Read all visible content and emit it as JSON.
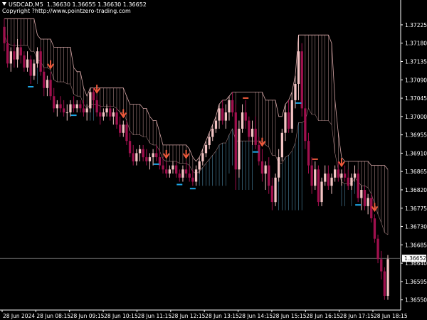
{
  "header": {
    "line1": "USDCAD,M5  1.36630 1.36655 1.36630 1.36652",
    "line2": "Copyright ?http://www.pointzero-trading.com"
  },
  "colors": {
    "background": "#000000",
    "bull_candle": "#f4c4c4",
    "bear_candle": "#a0104e",
    "cloud_bear": "#d8a8a8",
    "cloud_bull": "#6ab8e0",
    "arrow_down": "#f05a3c",
    "marker_low": "#1ea8e8",
    "marker_high": "#f05a3c",
    "axis_text": "#ffffff",
    "current_line": "#777777"
  },
  "current_price_label": "1.36652",
  "chart_data": {
    "type": "candlestick",
    "symbol": "USDCAD",
    "timeframe": "M5",
    "ylim": [
      1.36525,
      1.37265
    ],
    "yticks": [
      "1.37225",
      "1.37180",
      "1.37135",
      "1.37090",
      "1.37045",
      "1.37000",
      "1.36955",
      "1.36910",
      "1.36865",
      "1.36820",
      "1.36775",
      "1.36730",
      "1.36685",
      "1.36640",
      "1.36595",
      "1.36550"
    ],
    "xticks": [
      "28 Jun 2024",
      "28 Jun 08:15",
      "28 Jun 09:15",
      "28 Jun 10:15",
      "28 Jun 11:15",
      "28 Jun 12:15",
      "28 Jun 13:15",
      "28 Jun 14:15",
      "28 Jun 15:15",
      "28 Jun 16:15",
      "28 Jun 17:15",
      "28 Jun 18:15"
    ],
    "current_price": 1.36652,
    "candles": [
      [
        1.3722,
        1.3724,
        1.3716,
        1.3718
      ],
      [
        1.3718,
        1.372,
        1.3712,
        1.3713
      ],
      [
        1.3713,
        1.3717,
        1.3711,
        1.3716
      ],
      [
        1.3716,
        1.3718,
        1.3712,
        1.3714
      ],
      [
        1.3714,
        1.3719,
        1.3712,
        1.3717
      ],
      [
        1.3717,
        1.3719,
        1.3713,
        1.3715
      ],
      [
        1.3715,
        1.3716,
        1.3711,
        1.3712
      ],
      [
        1.3712,
        1.3716,
        1.3711,
        1.3714
      ],
      [
        1.3714,
        1.3715,
        1.3708,
        1.371
      ],
      [
        1.371,
        1.3714,
        1.3709,
        1.3713
      ],
      [
        1.3713,
        1.3717,
        1.3712,
        1.3716
      ],
      [
        1.3716,
        1.3717,
        1.371,
        1.3711
      ],
      [
        1.3711,
        1.3712,
        1.3705,
        1.3707
      ],
      [
        1.3707,
        1.371,
        1.3705,
        1.3709
      ],
      [
        1.3709,
        1.3711,
        1.3704,
        1.3705
      ],
      [
        1.3705,
        1.3707,
        1.3701,
        1.3702
      ],
      [
        1.3702,
        1.3704,
        1.37,
        1.3703
      ],
      [
        1.3703,
        1.3705,
        1.3701,
        1.3702
      ],
      [
        1.3702,
        1.3704,
        1.37,
        1.3701
      ],
      [
        1.3701,
        1.3703,
        1.3699,
        1.3701
      ],
      [
        1.3701,
        1.3704,
        1.37,
        1.3703
      ],
      [
        1.3703,
        1.3705,
        1.3701,
        1.3702
      ],
      [
        1.3702,
        1.3704,
        1.3701,
        1.3703
      ],
      [
        1.3703,
        1.3704,
        1.3701,
        1.3702
      ],
      [
        1.3702,
        1.3704,
        1.37,
        1.3701
      ],
      [
        1.3701,
        1.3703,
        1.3699,
        1.3702
      ],
      [
        1.3702,
        1.3707,
        1.3701,
        1.3706
      ],
      [
        1.3706,
        1.3707,
        1.3702,
        1.3704
      ],
      [
        1.3704,
        1.3705,
        1.37,
        1.3701
      ],
      [
        1.3701,
        1.3703,
        1.3698,
        1.37
      ],
      [
        1.37,
        1.3702,
        1.3699,
        1.3701
      ],
      [
        1.3701,
        1.3703,
        1.37,
        1.3702
      ],
      [
        1.3702,
        1.3703,
        1.3699,
        1.37
      ],
      [
        1.37,
        1.3702,
        1.3698,
        1.3701
      ],
      [
        1.3701,
        1.3702,
        1.3697,
        1.3698
      ],
      [
        1.3698,
        1.37,
        1.3695,
        1.3696
      ],
      [
        1.3696,
        1.3699,
        1.3695,
        1.3698
      ],
      [
        1.3698,
        1.3699,
        1.3693,
        1.3694
      ],
      [
        1.3694,
        1.3696,
        1.369,
        1.3691
      ],
      [
        1.3691,
        1.3693,
        1.3688,
        1.3689
      ],
      [
        1.3689,
        1.3692,
        1.3688,
        1.3691
      ],
      [
        1.3691,
        1.3693,
        1.3689,
        1.3692
      ],
      [
        1.3692,
        1.3693,
        1.3689,
        1.369
      ],
      [
        1.369,
        1.3692,
        1.3688,
        1.3689
      ],
      [
        1.3689,
        1.3691,
        1.3687,
        1.369
      ],
      [
        1.369,
        1.3692,
        1.3688,
        1.3691
      ],
      [
        1.3691,
        1.3693,
        1.3689,
        1.369
      ],
      [
        1.369,
        1.3692,
        1.3687,
        1.3688
      ],
      [
        1.3688,
        1.369,
        1.3686,
        1.3687
      ],
      [
        1.3687,
        1.3689,
        1.3685,
        1.3686
      ],
      [
        1.3686,
        1.3688,
        1.3685,
        1.3687
      ],
      [
        1.3687,
        1.3689,
        1.3686,
        1.3688
      ],
      [
        1.3688,
        1.3689,
        1.3685,
        1.3686
      ],
      [
        1.3686,
        1.3687,
        1.3684,
        1.3685
      ],
      [
        1.3685,
        1.3688,
        1.3684,
        1.3687
      ],
      [
        1.3687,
        1.3689,
        1.3685,
        1.3686
      ],
      [
        1.3686,
        1.3688,
        1.3684,
        1.3685
      ],
      [
        1.3685,
        1.3687,
        1.3683,
        1.3684
      ],
      [
        1.3684,
        1.3688,
        1.3683,
        1.3687
      ],
      [
        1.3687,
        1.369,
        1.3686,
        1.3689
      ],
      [
        1.3689,
        1.3692,
        1.3688,
        1.3691
      ],
      [
        1.3691,
        1.3694,
        1.369,
        1.3693
      ],
      [
        1.3693,
        1.3696,
        1.3692,
        1.3695
      ],
      [
        1.3695,
        1.3698,
        1.3694,
        1.3697
      ],
      [
        1.3697,
        1.37,
        1.3696,
        1.3699
      ],
      [
        1.3699,
        1.3703,
        1.3697,
        1.3702
      ],
      [
        1.3702,
        1.3704,
        1.3698,
        1.3699
      ],
      [
        1.3699,
        1.3703,
        1.3697,
        1.3701
      ],
      [
        1.3701,
        1.3705,
        1.3699,
        1.3704
      ],
      [
        1.3704,
        1.3706,
        1.37,
        1.3701
      ],
      [
        1.3701,
        1.3703,
        1.3682,
        1.3687
      ],
      [
        1.3687,
        1.3699,
        1.3685,
        1.3697
      ],
      [
        1.3697,
        1.3703,
        1.3696,
        1.3701
      ],
      [
        1.3701,
        1.3704,
        1.3697,
        1.3699
      ],
      [
        1.3699,
        1.37,
        1.3694,
        1.3695
      ],
      [
        1.3695,
        1.3699,
        1.3693,
        1.3697
      ],
      [
        1.3697,
        1.37,
        1.3692,
        1.3693
      ],
      [
        1.3693,
        1.3695,
        1.3688,
        1.3689
      ],
      [
        1.3689,
        1.3692,
        1.3684,
        1.3686
      ],
      [
        1.3686,
        1.3689,
        1.3682,
        1.3688
      ],
      [
        1.3688,
        1.369,
        1.3681,
        1.3683
      ],
      [
        1.3683,
        1.3685,
        1.3677,
        1.3679
      ],
      [
        1.3679,
        1.3686,
        1.3678,
        1.3685
      ],
      [
        1.3685,
        1.3692,
        1.3684,
        1.369
      ],
      [
        1.369,
        1.3697,
        1.3689,
        1.3696
      ],
      [
        1.3696,
        1.3703,
        1.3694,
        1.3701
      ],
      [
        1.3701,
        1.3704,
        1.3696,
        1.3697
      ],
      [
        1.3697,
        1.3706,
        1.3696,
        1.3704
      ],
      [
        1.3704,
        1.371,
        1.3702,
        1.3708
      ],
      [
        1.3708,
        1.372,
        1.3704,
        1.3716
      ],
      [
        1.3716,
        1.3718,
        1.37,
        1.3702
      ],
      [
        1.3702,
        1.3704,
        1.3692,
        1.3694
      ],
      [
        1.3694,
        1.3696,
        1.3686,
        1.3688
      ],
      [
        1.3688,
        1.369,
        1.3681,
        1.3683
      ],
      [
        1.3683,
        1.3689,
        1.3682,
        1.3687
      ],
      [
        1.3687,
        1.3688,
        1.3678,
        1.3679
      ],
      [
        1.3679,
        1.3685,
        1.3678,
        1.3684
      ],
      [
        1.3684,
        1.3688,
        1.3683,
        1.3686
      ],
      [
        1.3686,
        1.3688,
        1.3682,
        1.3683
      ],
      [
        1.3683,
        1.3686,
        1.3681,
        1.3685
      ],
      [
        1.3685,
        1.3688,
        1.3684,
        1.3687
      ],
      [
        1.3687,
        1.3689,
        1.3684,
        1.3685
      ],
      [
        1.3685,
        1.3687,
        1.3683,
        1.3686
      ],
      [
        1.3686,
        1.3688,
        1.3684,
        1.3685
      ],
      [
        1.3685,
        1.3687,
        1.3682,
        1.3683
      ],
      [
        1.3683,
        1.3686,
        1.3682,
        1.3685
      ],
      [
        1.3685,
        1.3688,
        1.3684,
        1.3686
      ],
      [
        1.3686,
        1.3687,
        1.3679,
        1.368
      ],
      [
        1.368,
        1.3683,
        1.3677,
        1.3682
      ],
      [
        1.3682,
        1.3683,
        1.3677,
        1.3678
      ],
      [
        1.3678,
        1.3681,
        1.3676,
        1.368
      ],
      [
        1.368,
        1.3681,
        1.3674,
        1.3675
      ],
      [
        1.3675,
        1.3676,
        1.3669,
        1.367
      ],
      [
        1.367,
        1.3671,
        1.3664,
        1.3665
      ],
      [
        1.3665,
        1.3667,
        1.366,
        1.3662
      ],
      [
        1.3662,
        1.3663,
        1.3655,
        1.3656
      ],
      [
        1.3656,
        1.3666,
        1.3655,
        1.3665
      ]
    ],
    "signals": [
      {
        "type": "down_arrow",
        "bar": 14
      },
      {
        "type": "down_arrow",
        "bar": 28
      },
      {
        "type": "down_arrow",
        "bar": 36
      },
      {
        "type": "down_arrow",
        "bar": 49
      },
      {
        "type": "down_arrow",
        "bar": 55
      },
      {
        "type": "down_arrow",
        "bar": 78
      },
      {
        "type": "down_arrow",
        "bar": 102
      },
      {
        "type": "down_arrow",
        "bar": 112
      },
      {
        "type": "down_arrow",
        "bar": 120
      },
      {
        "type": "down_arrow",
        "bar": 126
      },
      {
        "type": "low_marker",
        "bar": 8
      },
      {
        "type": "low_marker",
        "bar": 21
      },
      {
        "type": "low_marker",
        "bar": 46
      },
      {
        "type": "low_marker",
        "bar": 53
      },
      {
        "type": "low_marker",
        "bar": 57
      },
      {
        "type": "low_marker",
        "bar": 76
      },
      {
        "type": "low_marker",
        "bar": 89
      },
      {
        "type": "low_marker",
        "bar": 107
      },
      {
        "type": "low_marker",
        "bar": 122
      },
      {
        "type": "low_marker",
        "bar": 133
      },
      {
        "type": "high_marker",
        "bar": 73
      },
      {
        "type": "high_marker",
        "bar": 94
      }
    ]
  }
}
